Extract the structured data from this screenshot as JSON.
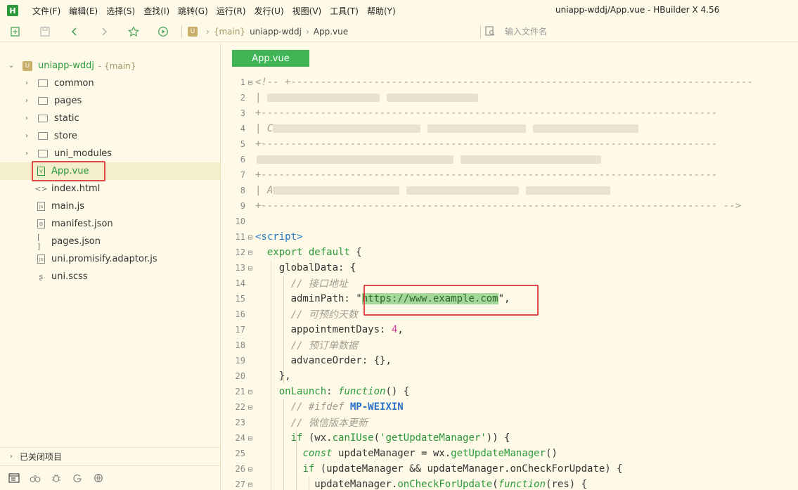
{
  "app": {
    "logo_letter": "H",
    "window_title": "uniapp-wddj/App.vue - HBuilder X 4.56",
    "menu": [
      "文件(F)",
      "编辑(E)",
      "选择(S)",
      "查找(I)",
      "跳转(G)",
      "运行(R)",
      "发行(U)",
      "视图(V)",
      "工具(T)",
      "帮助(Y)"
    ]
  },
  "toolbar": {
    "breadcrumb_branch": "{main}",
    "breadcrumb_project": "uniapp-wddj",
    "breadcrumb_file": "App.vue",
    "file_search_placeholder": "输入文件名",
    "icons": [
      "new-file-icon",
      "save-icon",
      "back-icon",
      "forward-icon",
      "favorite-icon",
      "run-icon"
    ]
  },
  "sidebar": {
    "root": {
      "name": "uniapp-wddj",
      "branch": "- {main}"
    },
    "items": [
      {
        "label": "common",
        "type": "folder"
      },
      {
        "label": "pages",
        "type": "folder"
      },
      {
        "label": "static",
        "type": "folder"
      },
      {
        "label": "store",
        "type": "folder"
      },
      {
        "label": "uni_modules",
        "type": "folder"
      },
      {
        "label": "App.vue",
        "type": "vue",
        "selected": true
      },
      {
        "label": "index.html",
        "type": "html"
      },
      {
        "label": "main.js",
        "type": "js"
      },
      {
        "label": "manifest.json",
        "type": "json-settings"
      },
      {
        "label": "pages.json",
        "type": "json"
      },
      {
        "label": "uni.promisify.adaptor.js",
        "type": "js"
      },
      {
        "label": "uni.scss",
        "type": "scss"
      }
    ],
    "closed_projects_label": "已关闭项目",
    "bottom_icons": [
      "project-manager-icon",
      "binoculars-icon",
      "bug-icon",
      "git-icon",
      "plugin-icon"
    ]
  },
  "editor": {
    "tab_label": "App.vue",
    "lines": [
      {
        "n": "1",
        "fold": "⊟"
      },
      {
        "n": "2"
      },
      {
        "n": "3"
      },
      {
        "n": "4"
      },
      {
        "n": "5"
      },
      {
        "n": "6"
      },
      {
        "n": "7"
      },
      {
        "n": "8"
      },
      {
        "n": "9"
      },
      {
        "n": "10"
      },
      {
        "n": "11",
        "fold": "⊟"
      },
      {
        "n": "12",
        "fold": "⊟"
      },
      {
        "n": "13",
        "fold": "⊟"
      },
      {
        "n": "14"
      },
      {
        "n": "15"
      },
      {
        "n": "16"
      },
      {
        "n": "17"
      },
      {
        "n": "18"
      },
      {
        "n": "19"
      },
      {
        "n": "20"
      },
      {
        "n": "21",
        "fold": "⊟"
      },
      {
        "n": "22",
        "fold": "⊟"
      },
      {
        "n": "23"
      },
      {
        "n": "24",
        "fold": "⊟"
      },
      {
        "n": "25"
      },
      {
        "n": "26",
        "fold": "⊟"
      },
      {
        "n": "27",
        "fold": "⊟"
      }
    ],
    "code": {
      "l1": "<!-- +------------------------------------------------------------------------------",
      "l2": "| ",
      "l3": "+-----------------------------------------------------------------------------",
      "l4": "| C",
      "l5": "+-----------------------------------------------------------------------------",
      "l6": "+-----------------------------------------------------------------------------",
      "l7": "+-----------------------------------------------------------------------------",
      "l8": "| A",
      "l9": "+----------------------------------------------------------------------------- -->",
      "l11": "<script>",
      "l12_kw": "export default",
      "l12_rest": " {",
      "l13": "globalData: {",
      "l14": "// 接口地址",
      "l15_key": "adminPath: ",
      "l15_q1": "\"",
      "l15_url": "https://www.example.com",
      "l15_q2": "\",",
      "l16": "// 可预约天数",
      "l17_key": "appointmentDays: ",
      "l17_num": "4",
      "l17_rest": ",",
      "l18": "// 预订单数据",
      "l19": "advanceOrder: {},",
      "l20": "},",
      "l21_fn": "onLaunch",
      "l21_mid": ": ",
      "l21_kw": "function",
      "l21_rest": "() {",
      "l22_c": "// #ifdef ",
      "l22_dir": "MP-WEIXIN",
      "l23": "// 微信版本更新",
      "l24_kw": "if",
      "l24_a": " (wx.",
      "l24_fn": "canIUse",
      "l24_b": "(",
      "l24_str": "'getUpdateManager'",
      "l24_c": ")) {",
      "l25_kw": "const",
      "l25_a": " updateManager = wx.",
      "l25_fn": "getUpdateManager",
      "l25_b": "()",
      "l26_kw": "if",
      "l26_a": " (updateManager && updateManager.onCheckForUpdate) {",
      "l27_a": "updateManager.",
      "l27_fn": "onCheckForUpdate",
      "l27_b": "(",
      "l27_kw": "function",
      "l27_c": "(res) {"
    }
  }
}
